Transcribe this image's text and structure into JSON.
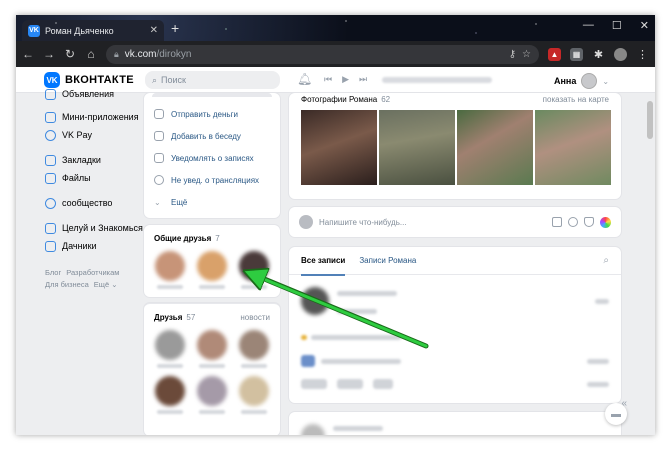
{
  "browser": {
    "tab_title": "Роман Дьяченко",
    "tab_close": "✕",
    "new_tab": "+",
    "url_host": "vk.com",
    "url_path": "/dirokyn",
    "window_controls": [
      "—",
      "☐",
      "✕"
    ]
  },
  "header": {
    "logo_text": "ВКОНТАКТЕ",
    "logo_mark": "VK",
    "search_placeholder": "Поиск",
    "user_name": "Анна"
  },
  "leftnav": {
    "items": [
      {
        "label": "Объявления"
      },
      {
        "label": "Мини-приложения"
      },
      {
        "label": "VK Pay"
      },
      {
        "label": "Закладки"
      },
      {
        "label": "Файлы"
      },
      {
        "label": "сообщество"
      },
      {
        "label": "Целуй и Знакомься"
      },
      {
        "label": "Дачники"
      }
    ],
    "footer": [
      "Блог",
      "Разработчикам",
      "Для бизнеса",
      "Ещё ⌄"
    ]
  },
  "actions": {
    "items": [
      {
        "label": "Отправить деньги"
      },
      {
        "label": "Добавить в беседу"
      },
      {
        "label": "Уведомлять о записях"
      },
      {
        "label": "Не увед. о трансляциях"
      },
      {
        "label": "Ещё"
      }
    ]
  },
  "common_friends": {
    "title": "Общие друзья",
    "count": "7"
  },
  "friends": {
    "title": "Друзья",
    "count": "57",
    "link": "новости"
  },
  "photos": {
    "title": "Фотографии Романа",
    "count": "62",
    "link": "показать на карте"
  },
  "composer": {
    "placeholder": "Напишите что-нибудь..."
  },
  "feed": {
    "tabs": [
      "Все записи",
      "Записи Романа"
    ]
  },
  "colors": {
    "accent": "#0077ff",
    "link": "#2a5885",
    "arrow": "#2ecc40"
  }
}
